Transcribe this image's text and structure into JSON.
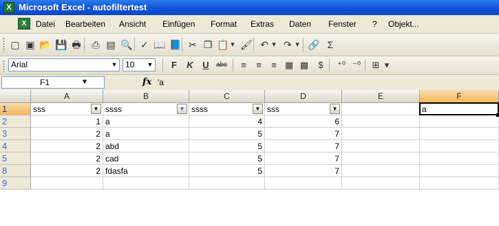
{
  "window": {
    "app_icon": "X",
    "title": "Microsoft Excel - autofiltertest"
  },
  "menubar": {
    "doc_icon": "X",
    "items": [
      "Datei",
      "Bearbeiten",
      "Ansicht",
      "Einfügen",
      "Format",
      "Extras",
      "Daten",
      "Fenster",
      "?",
      "Objekt..."
    ]
  },
  "toolbar_standard": {
    "buttons": [
      {
        "name": "new-document-icon",
        "glyph": "▢"
      },
      {
        "name": "permission-icon",
        "glyph": "▣"
      },
      {
        "name": "open-folder-icon",
        "glyph": "📂"
      },
      {
        "name": "save-icon",
        "glyph": "💾"
      },
      {
        "name": "print-icon",
        "glyph": "🖶"
      },
      {
        "name": "print-preview-icon",
        "glyph": "⎙"
      },
      {
        "name": "research-icon",
        "glyph": "▤"
      },
      {
        "name": "preview-icon",
        "glyph": "🔍"
      },
      {
        "name": "spellcheck-icon",
        "glyph": "✓"
      },
      {
        "name": "research-book-icon",
        "glyph": "📖"
      },
      {
        "name": "reference-icon",
        "glyph": "📘"
      },
      {
        "name": "cut-icon",
        "glyph": "✂"
      },
      {
        "name": "copy-icon",
        "glyph": "❐"
      },
      {
        "name": "paste-icon",
        "glyph": "📋"
      },
      {
        "name": "paste-dropdown-icon",
        "glyph": "▾"
      },
      {
        "name": "format-painter-icon",
        "glyph": "🖌"
      },
      {
        "name": "undo-icon",
        "glyph": "↶"
      },
      {
        "name": "undo-dropdown-icon",
        "glyph": "▾"
      },
      {
        "name": "redo-icon",
        "glyph": "↷"
      },
      {
        "name": "redo-dropdown-icon",
        "glyph": "▾"
      },
      {
        "name": "hyperlink-icon",
        "glyph": "🔗"
      },
      {
        "name": "autosum-icon",
        "glyph": "Σ"
      }
    ]
  },
  "toolbar_format": {
    "font_name": "Arial",
    "font_size": "10",
    "buttons": [
      {
        "name": "bold-icon",
        "glyph": "F"
      },
      {
        "name": "italic-icon",
        "glyph": "K"
      },
      {
        "name": "underline-icon",
        "glyph": "U"
      },
      {
        "name": "strikethrough-icon",
        "glyph": "abc"
      },
      {
        "name": "align-left-icon",
        "glyph": "≡"
      },
      {
        "name": "align-center-icon",
        "glyph": "≡"
      },
      {
        "name": "align-right-icon",
        "glyph": "≡"
      },
      {
        "name": "merge-center-icon",
        "glyph": "▦"
      },
      {
        "name": "borders-grid-icon",
        "glyph": "▩"
      },
      {
        "name": "currency-icon",
        "glyph": "$"
      },
      {
        "name": "increase-decimal-icon",
        "glyph": "⁺⁰"
      },
      {
        "name": "decrease-decimal-icon",
        "glyph": "⁻⁰"
      },
      {
        "name": "borders-icon",
        "glyph": "⊞"
      },
      {
        "name": "borders-dropdown-icon",
        "glyph": "▾"
      }
    ]
  },
  "formula_bar": {
    "name_box": "F1",
    "fx_label": "fx",
    "formula": "'a"
  },
  "sheet": {
    "columns": [
      "A",
      "B",
      "C",
      "D",
      "E",
      "F"
    ],
    "active_column": "F",
    "active_row": "1",
    "rows": [
      {
        "label": "1",
        "cells": [
          "sss",
          "ssss",
          "ssss",
          "sss",
          "",
          "a"
        ]
      },
      {
        "label": "2",
        "cells": [
          "1",
          "a",
          "4",
          "6",
          "",
          ""
        ]
      },
      {
        "label": "3",
        "cells": [
          "2",
          "a",
          "5",
          "7",
          "",
          ""
        ]
      },
      {
        "label": "4",
        "cells": [
          "2",
          "abd",
          "5",
          "7",
          "",
          ""
        ]
      },
      {
        "label": "5",
        "cells": [
          "2",
          "cad",
          "5",
          "7",
          "",
          ""
        ]
      },
      {
        "label": "8",
        "cells": [
          "2",
          "fdasfa",
          "5",
          "7",
          "",
          ""
        ]
      },
      {
        "label": "9",
        "cells": [
          "",
          "",
          "",
          "",
          "",
          ""
        ]
      }
    ],
    "filter_columns": [
      0,
      1,
      2,
      3
    ],
    "active_filter_column": 1
  }
}
